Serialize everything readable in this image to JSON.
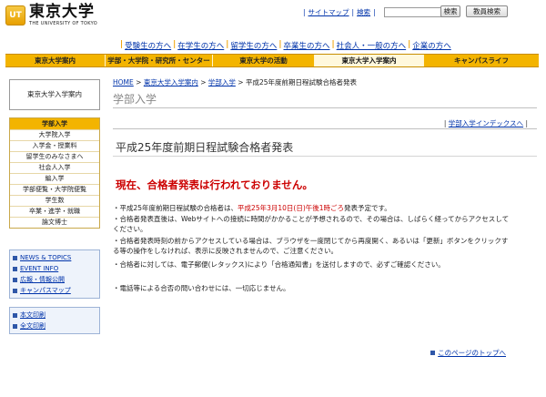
{
  "header": {
    "logo_mark": "UT",
    "logo_jp": "東京大学",
    "logo_en": "THE UNIVERSITY OF TOKYO",
    "sitemap_label": "サイトマップ",
    "search_link_label": "検索",
    "search_placeholder": "",
    "search_button": "検索",
    "staff_search_button": "教員検索"
  },
  "audience": {
    "items": [
      "受験生の方へ",
      "在学生の方へ",
      "留学生の方へ",
      "卒業生の方へ",
      "社会人・一般の方へ",
      "企業の方へ"
    ]
  },
  "nav": {
    "tabs": [
      "東京大学案内",
      "学部・大学院・研究所・センター",
      "東京大学の活動",
      "東京大学入学案内",
      "キャンパスライフ"
    ],
    "active_index": 3
  },
  "sidebar": {
    "title": "東京大学入学案内",
    "menu_head": "学部入学",
    "menu_items": [
      "大学院入学",
      "入学金・授業料",
      "留学生のみなさまへ",
      "社会人入学",
      "編入学",
      "学部便覧・大学院便覧",
      "学生数",
      "卒業・進学・就職",
      "論文博士"
    ],
    "links_a": [
      "NEWS & TOPICS",
      "EVENT INFO",
      "広報・情報公開",
      "キャンパスマップ"
    ],
    "links_b": [
      "本文印刷",
      "全文印刷"
    ]
  },
  "breadcrumb": {
    "items": [
      "HOME",
      "東京大学入学案内",
      "学部入学"
    ],
    "current": "平成25年度前期日程試験合格者発表"
  },
  "main": {
    "section_title": "学部入学",
    "index_link": "学部入学インデックスへ",
    "page_title": "平成25年度前期日程試験合格者発表",
    "notice": "現在、合格者発表は行われておりません。",
    "b1_a": "・平成25年度前期日程試験の合格者は、",
    "b1_red": "平成25年3月10日(日)午後1時ごろ",
    "b1_b": "発表予定です。",
    "b2": "・合格者発表直後は、Webサイトへの接続に時間がかかることが予想されるので、その場合は、しばらく経ってからアクセスしてください。",
    "b3_a": "・合格者発表時刻の前からアクセスしている場合は、ブラウザを一度閉じてから再度開く、あるいは「更新」ボタンをクリックする等の操作をしなければ、表示に反映されませんので、",
    "b3_b": "ご注意ください。",
    "b4": "・合格者に対しては、電子郵便(レタックス)により「合格通知書」を送付しますので、必ずご確認ください。",
    "b5": "・電話等による合否の問い合わせには、一切応じません。",
    "top_link": "このページのトップへ"
  }
}
